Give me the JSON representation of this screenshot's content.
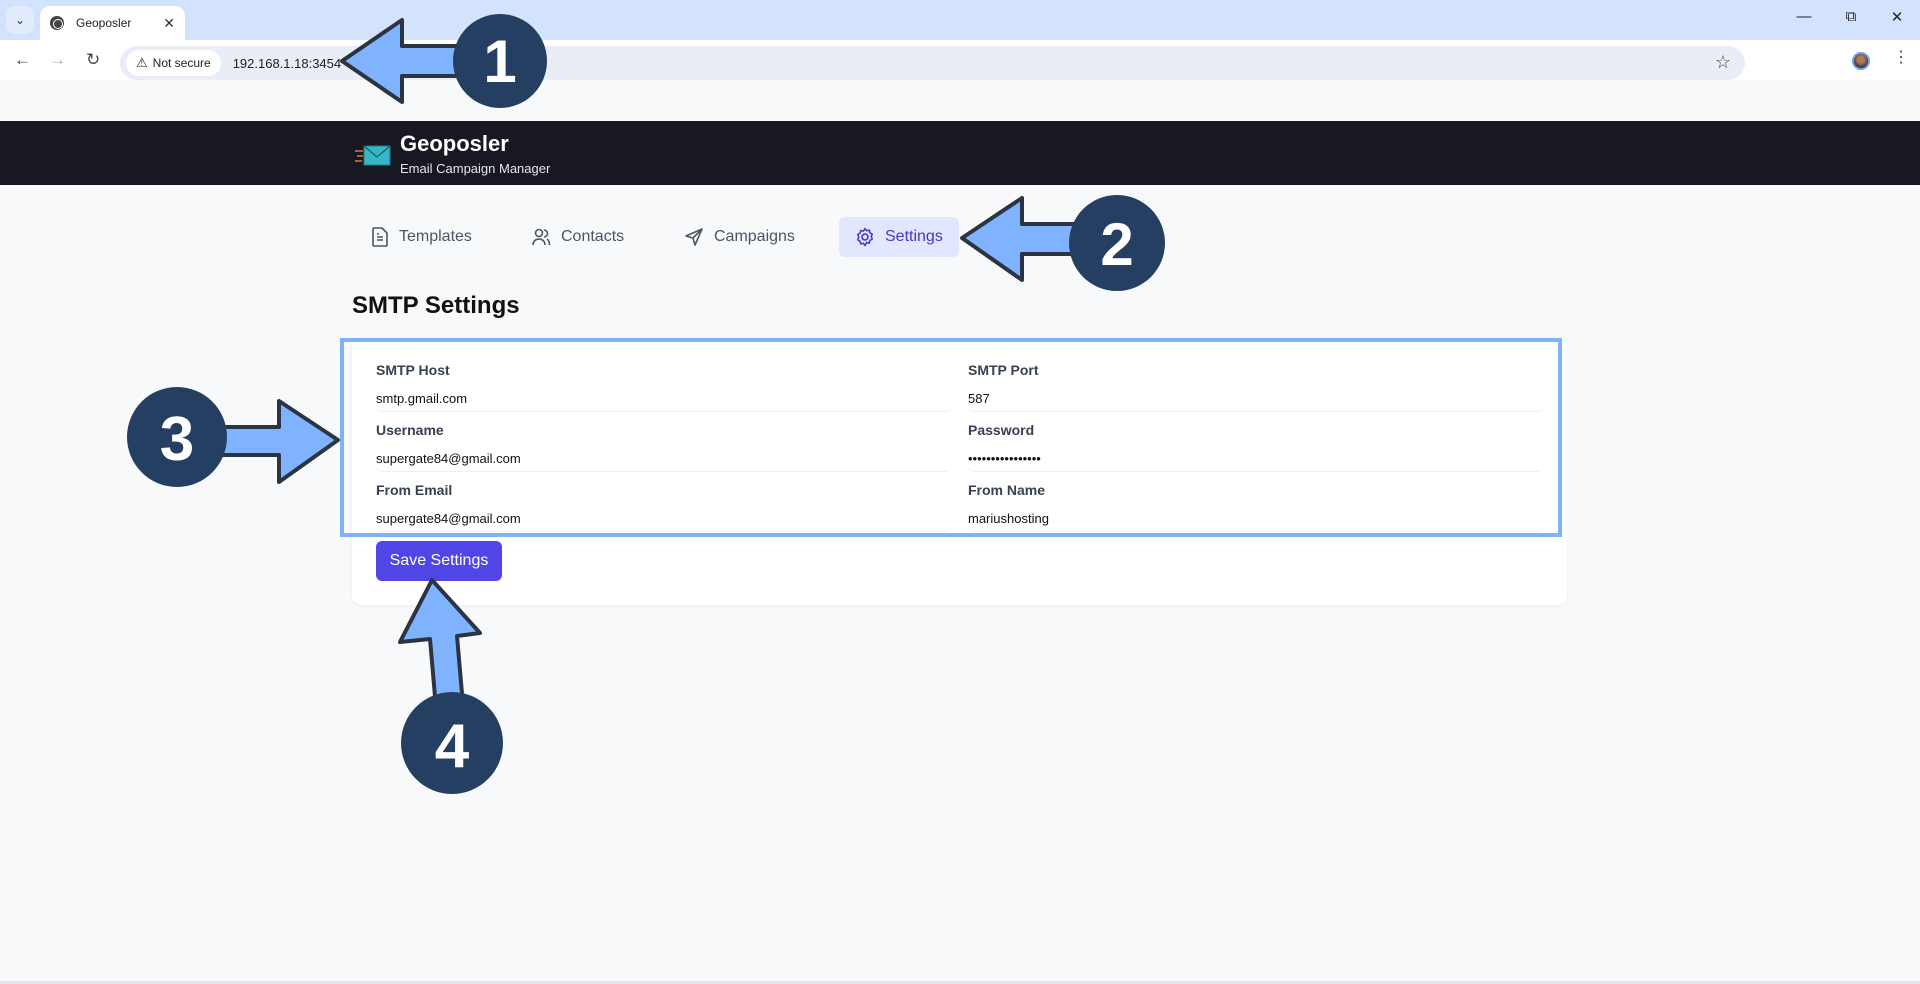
{
  "browser": {
    "tab_title": "Geoposler",
    "security_label": "Not secure",
    "url": "192.168.1.18:3454"
  },
  "app": {
    "title": "Geoposler",
    "subtitle": "Email Campaign Manager"
  },
  "nav": {
    "items": [
      {
        "label": "Templates",
        "icon": "document-icon",
        "active": false
      },
      {
        "label": "Contacts",
        "icon": "users-icon",
        "active": false
      },
      {
        "label": "Campaigns",
        "icon": "send-icon",
        "active": false
      },
      {
        "label": "Settings",
        "icon": "gear-icon",
        "active": true
      }
    ]
  },
  "page": {
    "title": "SMTP Settings"
  },
  "form": {
    "smtp_host": {
      "label": "SMTP Host",
      "value": "smtp.gmail.com"
    },
    "smtp_port": {
      "label": "SMTP Port",
      "value": "587"
    },
    "username": {
      "label": "Username",
      "value": "supergate84@gmail.com"
    },
    "password": {
      "label": "Password",
      "value": "••••••••••••••••"
    },
    "from_email": {
      "label": "From Email",
      "value": "supergate84@gmail.com"
    },
    "from_name": {
      "label": "From Name",
      "value": "mariushosting"
    },
    "save_label": "Save Settings"
  },
  "annotations": {
    "step1": "1",
    "step2": "2",
    "step3": "3",
    "step4": "4",
    "arrow_fill": "#80b3ff",
    "badge_fill": "#253f63"
  }
}
